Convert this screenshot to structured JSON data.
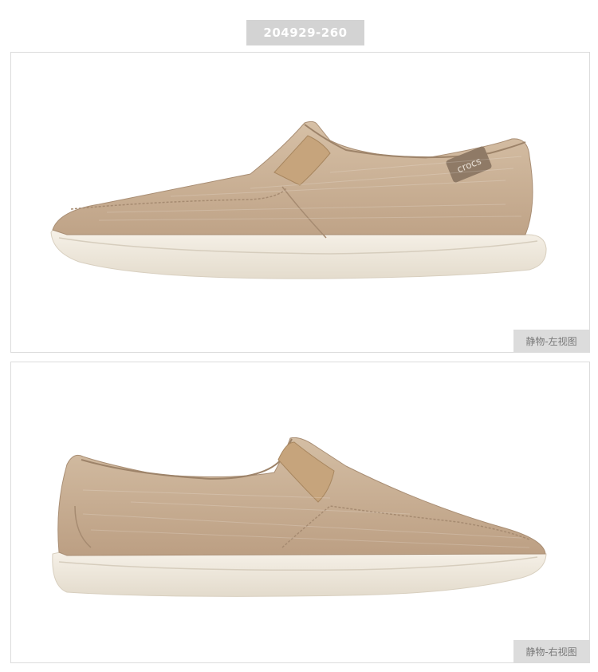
{
  "product": {
    "sku": "204929-260",
    "brand_logo_text": "crocs",
    "colors": {
      "upper": "#cdb49a",
      "upper_shadow": "#b89c82",
      "sole": "#f1ebe0",
      "elastic_gore": "#c9a983"
    }
  },
  "views": [
    {
      "label": "静物-左视图"
    },
    {
      "label": "静物-右视图"
    }
  ]
}
